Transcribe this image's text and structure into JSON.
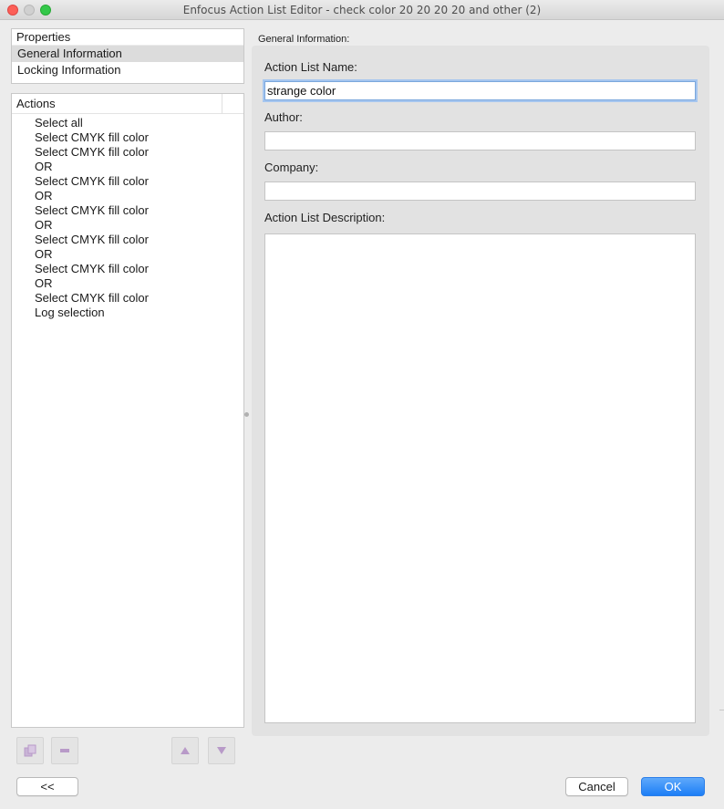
{
  "window": {
    "title": "Enfocus Action List Editor - check color 20 20 20 20 and other (2)"
  },
  "properties": {
    "header": "Properties",
    "items": [
      {
        "label": "General Information",
        "selected": true
      },
      {
        "label": "Locking Information",
        "selected": false
      }
    ]
  },
  "actions": {
    "header": "Actions",
    "items": [
      "Select all",
      "Select CMYK fill color",
      "Select CMYK fill color",
      "OR",
      "Select CMYK fill color",
      "OR",
      "Select CMYK fill color",
      "OR",
      "Select CMYK fill color",
      "OR",
      "Select CMYK fill color",
      "OR",
      "Select CMYK fill color",
      "Log selection"
    ]
  },
  "toolbar": {
    "add_icon": "add-action-icon",
    "remove_icon": "remove-action-icon",
    "up_icon": "move-up-icon",
    "down_icon": "move-down-icon",
    "icon_color": "#b89ac8"
  },
  "general_info": {
    "section_label": "General Information:",
    "name_label": "Action List Name:",
    "name_value": "strange color",
    "author_label": "Author:",
    "author_value": "",
    "company_label": "Company:",
    "company_value": "",
    "description_label": "Action List Description:",
    "description_value": ""
  },
  "buttons": {
    "collapse": "<<",
    "cancel": "Cancel",
    "ok": "OK"
  },
  "colors": {
    "accent": "#1c7ef6",
    "selection": "#dcdcdc",
    "focus_ring": "#a6c6ef"
  }
}
